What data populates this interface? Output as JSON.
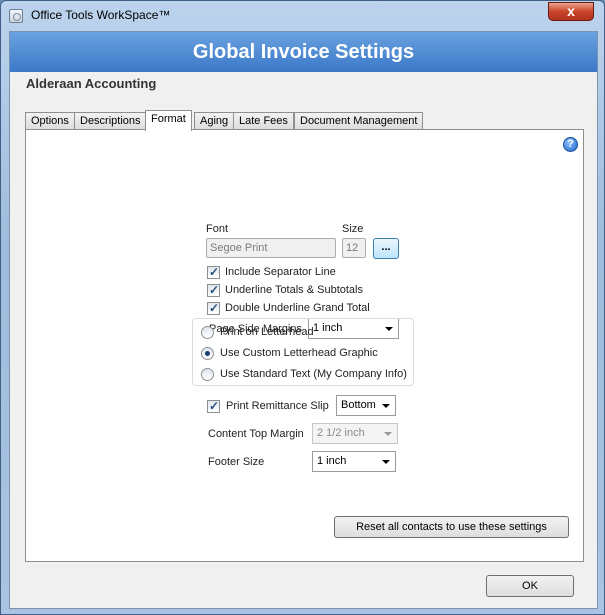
{
  "window": {
    "title": "Office Tools WorkSpace™",
    "close_label": "x"
  },
  "header": {
    "title": "Global Invoice Settings",
    "company": "Alderaan Accounting"
  },
  "tabs": [
    "Options",
    "Descriptions",
    "Format",
    "Aging",
    "Late Fees",
    "Document Management"
  ],
  "active_tab": "Format",
  "format": {
    "font_label": "Font",
    "font_value": "Segoe Print",
    "size_label": "Size",
    "size_value": "12",
    "browse_label": "...",
    "include_separator": {
      "label": "Include Separator Line",
      "checked": true
    },
    "underline_totals": {
      "label": "Underline Totals & Subtotals",
      "checked": true
    },
    "double_underline": {
      "label": "Double Underline Grand Total",
      "checked": true
    },
    "margins_label": "Page Side Margins",
    "margins_value": "1 inch",
    "print_letterhead": {
      "label": "Print on Letterhead",
      "selected": false
    },
    "custom_letterhead": {
      "label": "Use Custom Letterhead Graphic",
      "selected": true
    },
    "standard_text": {
      "label": "Use Standard Text (My Company Info)",
      "selected": false
    },
    "remittance": {
      "label": "Print Remittance Slip",
      "checked": true
    },
    "remittance_position": "Bottom",
    "content_top_label": "Content Top Margin",
    "content_top_value": "2 1/2 inch",
    "footer_label": "Footer Size",
    "footer_value": "1 inch",
    "reset_button": "Reset all contacts to use these settings"
  },
  "footer": {
    "ok_label": "OK"
  }
}
